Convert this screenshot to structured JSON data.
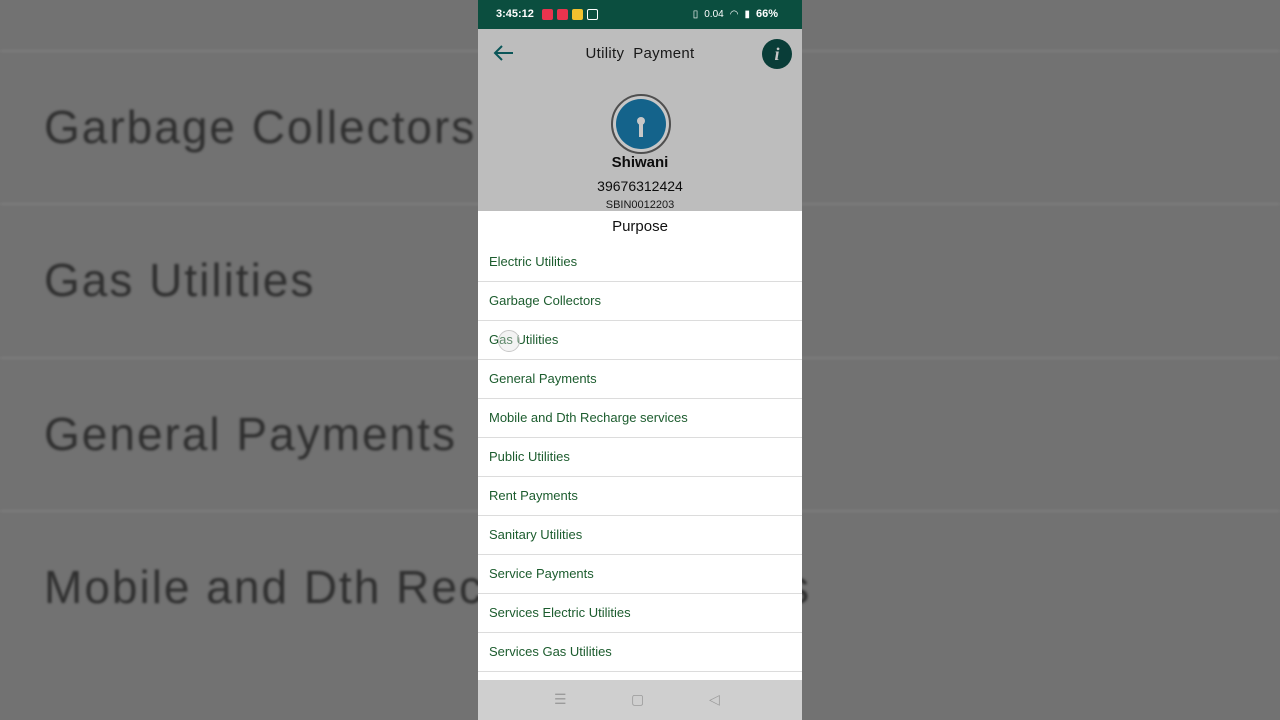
{
  "background": {
    "rows": [
      "Garbage Collectors",
      "Gas Utilities",
      "General Payments",
      "Mobile and Dth Recharge services"
    ]
  },
  "status_bar": {
    "time": "3:45:12",
    "network_speed": "0.04",
    "battery": "66%",
    "notification_colors": [
      "#e8344e",
      "#e8344e",
      "#f2c12e",
      "#ffffff"
    ]
  },
  "app_bar": {
    "back_icon": "arrow-left-icon",
    "title": "Utility  Payment",
    "info_icon": "info-icon"
  },
  "payee": {
    "name": "Shiwani",
    "account_number": "39676312424",
    "ifsc": "SBIN0012203"
  },
  "purpose_sheet": {
    "title": "Purpose",
    "options": [
      "Electric Utilities",
      "Garbage Collectors",
      "Gas Utilities",
      "General Payments",
      "Mobile and Dth Recharge services",
      "Public Utilities",
      "Rent Payments",
      "Sanitary Utilities",
      "Service Payments",
      "Services Electric Utilities",
      "Services Gas Utilities"
    ]
  },
  "nav_bar": {
    "recents_icon": "menu-icon",
    "home_icon": "square-icon",
    "back_icon": "triangle-back-icon"
  },
  "colors": {
    "status_bar": "#0b4e3f",
    "accent": "#0f6f73",
    "option_text": "#1c5c2e"
  }
}
